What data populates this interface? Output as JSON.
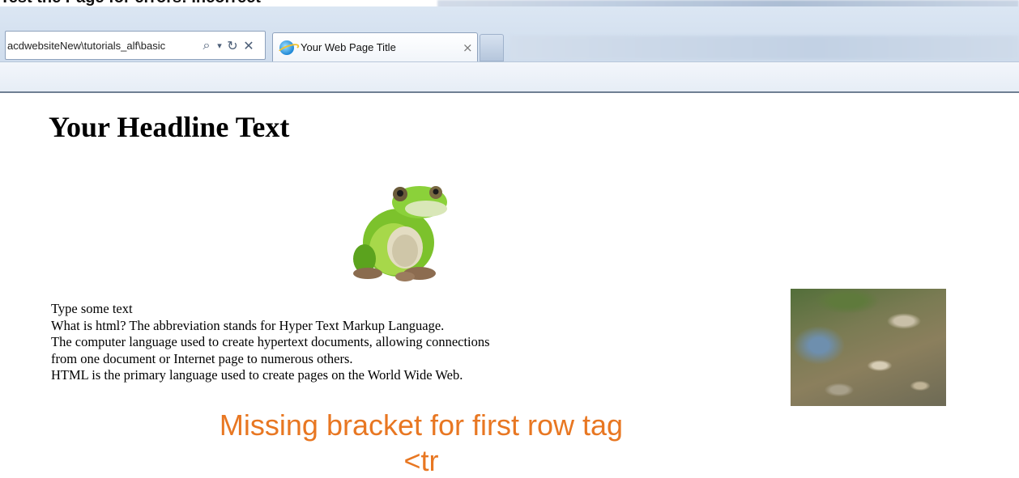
{
  "caption": {
    "text": "Test the Page for errors: Incorrect"
  },
  "browser": {
    "address": "acdwebsiteNew\\tutorials_alf\\basic",
    "address_icons": [
      "search-icon",
      "dropdown-icon",
      "refresh-icon",
      "stop-icon"
    ],
    "tab": {
      "title": "Your Web Page Title",
      "close": "×"
    }
  },
  "page": {
    "headline": "Your Headline Text",
    "paragraph_lines": [
      "Type some text",
      "What is html? The abbreviation stands for Hyper Text Markup Language.",
      "The computer language used to create hypertext documents, allowing connections",
      "from one document or Internet page to numerous others.",
      "HTML is the primary language used to create pages on the World Wide Web."
    ]
  },
  "annotation": {
    "line1": "Missing bracket for first row tag",
    "line2": "<tr",
    "color": "#e87722"
  }
}
